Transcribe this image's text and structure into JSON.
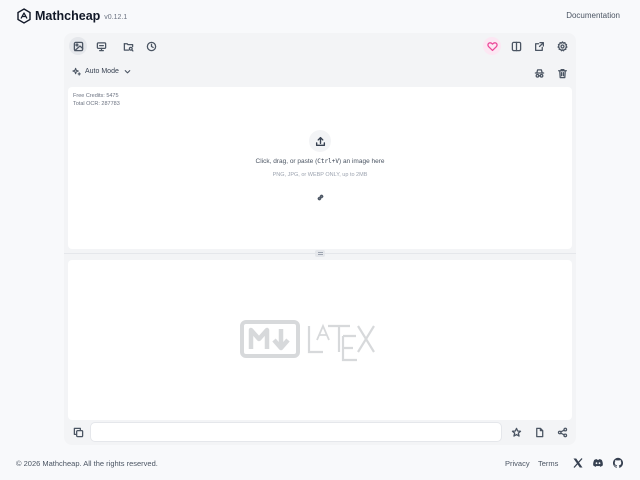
{
  "header": {
    "brand": "Mathcheap",
    "version": "v0.12.1",
    "documentation": "Documentation"
  },
  "toolbar": {
    "left_tools": [
      {
        "icon": "image-scan-icon",
        "active": true
      },
      {
        "icon": "presentation-icon",
        "active": false
      },
      {
        "icon": "folder-search-icon",
        "active": false
      },
      {
        "icon": "history-icon",
        "active": false
      }
    ],
    "right_tools": [
      {
        "icon": "heart-icon",
        "color": "#ec4899"
      },
      {
        "icon": "split-view-icon"
      },
      {
        "icon": "share-square-icon"
      },
      {
        "icon": "gear-icon"
      }
    ],
    "mode_label": "Auto Mode"
  },
  "upload": {
    "credits_label": "Free Credits: 5475",
    "ocr_label": "Total OCR: 287783",
    "prompt_before": "Click, drag, or paste (",
    "prompt_kbd": "Ctrl+V",
    "prompt_after": ") an image here",
    "hint": "PNG, JPG, or WEBP ONLY, up to 2MB"
  },
  "bottom": {
    "input_value": ""
  },
  "footer": {
    "copyright": "© 2026 Mathcheap. All the rights reserved.",
    "privacy": "Privacy",
    "terms": "Terms"
  },
  "colors": {
    "accent_pink": "#ec4899",
    "background": "#f8f9fb",
    "panel": "#f3f4f6"
  }
}
